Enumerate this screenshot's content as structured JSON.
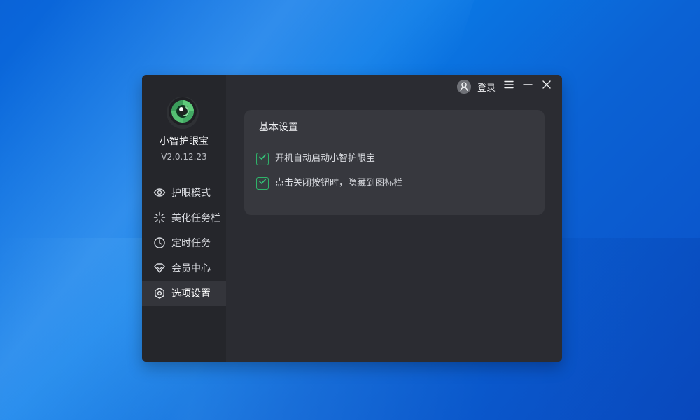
{
  "app": {
    "name": "小智护眼宝",
    "version": "V2.0.12.23",
    "logo_icon": "green-eye-shutter-logo-icon"
  },
  "colors": {
    "desktop_blue": "#0a6ddc",
    "sidebar_bg": "#25262b",
    "content_bg": "#2b2c32",
    "card_bg": "#37383e",
    "active_nav_bg": "#34353b",
    "accent_green": "#2fb36a"
  },
  "header": {
    "login_label": "登录",
    "avatar_icon": "user-avatar-icon",
    "menu_icon": "menu-icon",
    "minimize_icon": "minimize-icon",
    "close_icon": "close-icon"
  },
  "sidebar": {
    "items": [
      {
        "label": "护眼模式",
        "icon": "eye-icon",
        "active": false
      },
      {
        "label": "美化任务栏",
        "icon": "sparkle-icon",
        "active": false
      },
      {
        "label": "定时任务",
        "icon": "clock-icon",
        "active": false
      },
      {
        "label": "会员中心",
        "icon": "diamond-icon",
        "active": false
      },
      {
        "label": "选项设置",
        "icon": "settings-icon",
        "active": true
      }
    ]
  },
  "main": {
    "section_title": "基本设置",
    "options": [
      {
        "label": "开机自动启动小智护眼宝",
        "checked": true
      },
      {
        "label": "点击关闭按钮时，隐藏到图标栏",
        "checked": true
      }
    ]
  }
}
